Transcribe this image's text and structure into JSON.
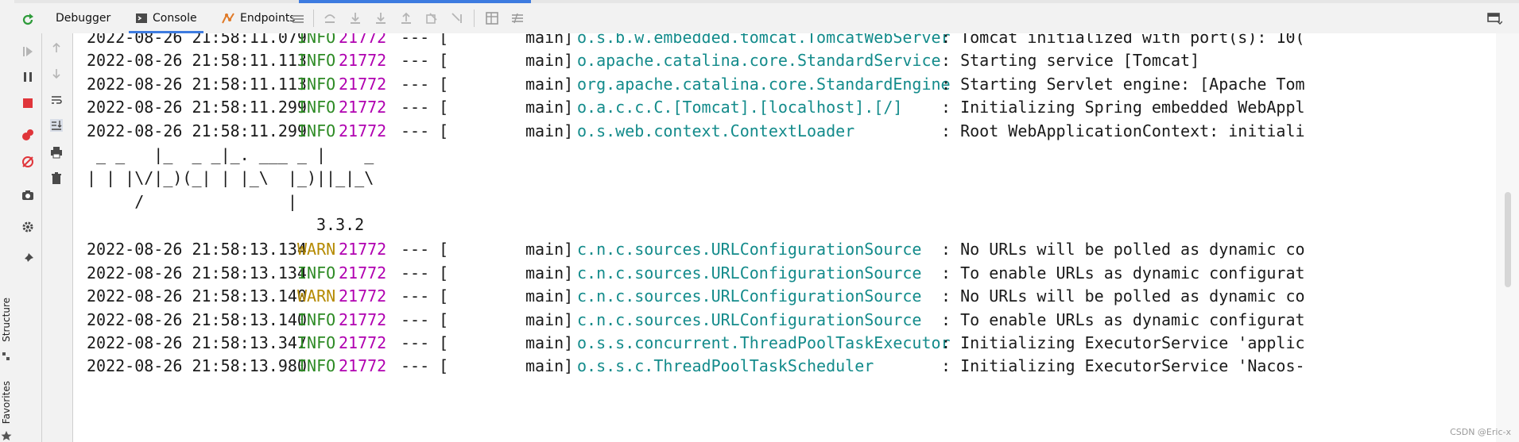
{
  "toolbar": {
    "tabs": [
      {
        "label": "Debugger",
        "icon": "none"
      },
      {
        "label": "Console",
        "icon": "console-icon"
      },
      {
        "label": "Endpoints",
        "icon": "endpoints-icon"
      }
    ],
    "progress": 0.25
  },
  "side_strip": {
    "structure_label": "Structure",
    "favorites_label": "Favorites"
  },
  "console": {
    "lines": [
      {
        "kind": "log",
        "ts": "2022-08-26 21:58:11.079",
        "level": "INFO",
        "pid": "21772",
        "sep": "--- [",
        "thread": "main]",
        "logger": "o.s.b.w.embedded.tomcat.TomcatWebServer",
        "msg": ": Tomcat initialized with port(s): 10("
      },
      {
        "kind": "log",
        "ts": "2022-08-26 21:58:11.113",
        "level": "INFO",
        "pid": "21772",
        "sep": "--- [",
        "thread": "main]",
        "logger": "o.apache.catalina.core.StandardService",
        "msg": ": Starting service [Tomcat]"
      },
      {
        "kind": "log",
        "ts": "2022-08-26 21:58:11.113",
        "level": "INFO",
        "pid": "21772",
        "sep": "--- [",
        "thread": "main]",
        "logger": "org.apache.catalina.core.StandardEngine",
        "msg": ": Starting Servlet engine: [Apache Tom"
      },
      {
        "kind": "log",
        "ts": "2022-08-26 21:58:11.299",
        "level": "INFO",
        "pid": "21772",
        "sep": "--- [",
        "thread": "main]",
        "logger": "o.a.c.c.C.[Tomcat].[localhost].[/]",
        "msg": ": Initializing Spring embedded WebAppl"
      },
      {
        "kind": "log",
        "ts": "2022-08-26 21:58:11.299",
        "level": "INFO",
        "pid": "21772",
        "sep": "--- [",
        "thread": "main]",
        "logger": "o.s.web.context.ContextLoader",
        "msg": ": Root WebApplicationContext: initiali"
      },
      {
        "kind": "banner",
        "text": " _ _   |_  _ _|_. ___ _ |    _"
      },
      {
        "kind": "banner",
        "text": "| | |\\/|_)(_| | |_\\  |_)||_|_\\"
      },
      {
        "kind": "banner",
        "text": "     /               |"
      },
      {
        "kind": "banner",
        "text": "                        3.3.2"
      },
      {
        "kind": "log",
        "ts": "2022-08-26 21:58:13.134",
        "level": "WARN",
        "pid": "21772",
        "sep": "--- [",
        "thread": "main]",
        "logger": "c.n.c.sources.URLConfigurationSource",
        "msg": ": No URLs will be polled as dynamic co"
      },
      {
        "kind": "log",
        "ts": "2022-08-26 21:58:13.134",
        "level": "INFO",
        "pid": "21772",
        "sep": "--- [",
        "thread": "main]",
        "logger": "c.n.c.sources.URLConfigurationSource",
        "msg": ": To enable URLs as dynamic configurat"
      },
      {
        "kind": "log",
        "ts": "2022-08-26 21:58:13.140",
        "level": "WARN",
        "pid": "21772",
        "sep": "--- [",
        "thread": "main]",
        "logger": "c.n.c.sources.URLConfigurationSource",
        "msg": ": No URLs will be polled as dynamic co"
      },
      {
        "kind": "log",
        "ts": "2022-08-26 21:58:13.140",
        "level": "INFO",
        "pid": "21772",
        "sep": "--- [",
        "thread": "main]",
        "logger": "c.n.c.sources.URLConfigurationSource",
        "msg": ": To enable URLs as dynamic configurat"
      },
      {
        "kind": "log",
        "ts": "2022-08-26 21:58:13.347",
        "level": "INFO",
        "pid": "21772",
        "sep": "--- [",
        "thread": "main]",
        "logger": "o.s.s.concurrent.ThreadPoolTaskExecutor",
        "msg": ": Initializing ExecutorService 'applic"
      },
      {
        "kind": "log",
        "ts": "2022-08-26 21:58:13.980",
        "level": "INFO",
        "pid": "21772",
        "sep": "--- [",
        "thread": "main]",
        "logger": "o.s.s.c.ThreadPoolTaskScheduler",
        "msg": ": Initializing ExecutorService 'Nacos-"
      }
    ]
  },
  "watermark": "CSDN @Eric-x",
  "colors": {
    "info": "#2d8a24",
    "warn": "#b58a00",
    "pid": "#b000b0",
    "logger": "#138b8b",
    "accent": "#3d7be0",
    "run_green": "#2e9b3a",
    "stop_red": "#e0353a"
  }
}
